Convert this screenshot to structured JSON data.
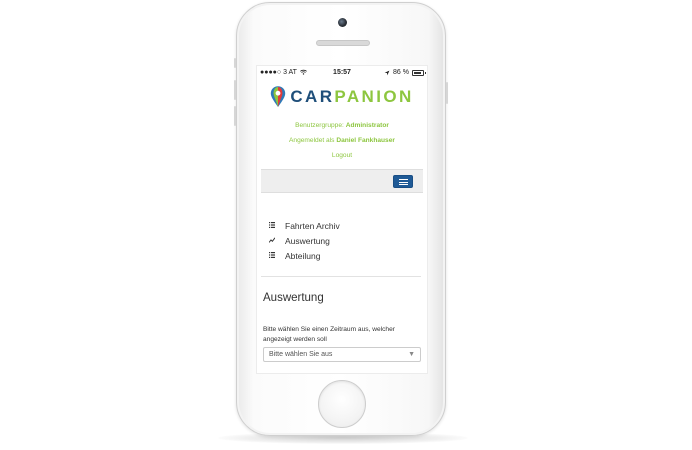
{
  "status_bar": {
    "signal": "●●●●○ 3 AT",
    "wifi_icon": "wifi-icon",
    "time": "15:57",
    "location_icon": "location-arrow-icon",
    "battery_text": "86 %",
    "battery_level": 0.86
  },
  "logo": {
    "icon": "map-pin-icon",
    "car": "CAR",
    "panion": "PANION",
    "colors": {
      "car": "#1f4f7a",
      "panion": "#8dc63f"
    }
  },
  "user_info": {
    "group_label": "Benutzergruppe:",
    "group_value": "Administrator",
    "logged_in_label": "Angemeldet als",
    "logged_in_value": "Daniel Fankhauser",
    "logout": "Logout"
  },
  "navbar": {
    "toggle_icon": "hamburger-icon",
    "accent": "#1f5a96"
  },
  "menu": {
    "items": [
      {
        "label": "Fahrten Archiv",
        "icon": "list-icon"
      },
      {
        "label": "Auswertung",
        "icon": "chart-line-icon"
      },
      {
        "label": "Abteilung",
        "icon": "list-icon"
      }
    ]
  },
  "main": {
    "title": "Auswertung",
    "help_text": "Bitte wählen Sie einen Zeitraum aus, welcher angezeigt werden soll",
    "select": {
      "value": "Bitte wählen Sie aus",
      "icon": "caret-down-icon"
    }
  }
}
